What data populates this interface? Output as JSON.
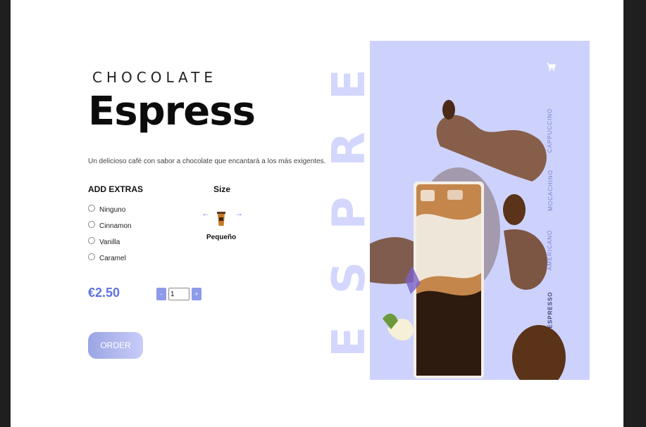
{
  "product": {
    "eyebrow": "CHOCOLATE",
    "title": "Espress",
    "description": "Un delicioso café con sabor a chocolate que encantará a los más exigentes."
  },
  "extras": {
    "title": "ADD EXTRAS",
    "options": [
      "Ninguno",
      "Cinnamon",
      "Vanilla",
      "Caramel"
    ]
  },
  "size": {
    "title": "Size",
    "selected_label": "Pequeño",
    "prev_icon": "arrow-left-icon",
    "next_icon": "arrow-right-icon"
  },
  "price": "€2.50",
  "quantity": {
    "value": "1",
    "minus_label": "-",
    "plus_label": "+"
  },
  "order_label": "ORDER",
  "hero": {
    "big_letters": [
      "E",
      "R",
      "P",
      "S",
      "E"
    ]
  },
  "nav": {
    "cart_icon": "cart-icon",
    "items": [
      "CAPPUCCINO",
      "MOCACHINO",
      "AMERICANO",
      "ESPRESSO"
    ],
    "active": "ESPRESSO"
  },
  "colors": {
    "accent": "#5f72e0",
    "panel_bg": "#cdd2fd",
    "big_text": "#d3d7fd"
  }
}
